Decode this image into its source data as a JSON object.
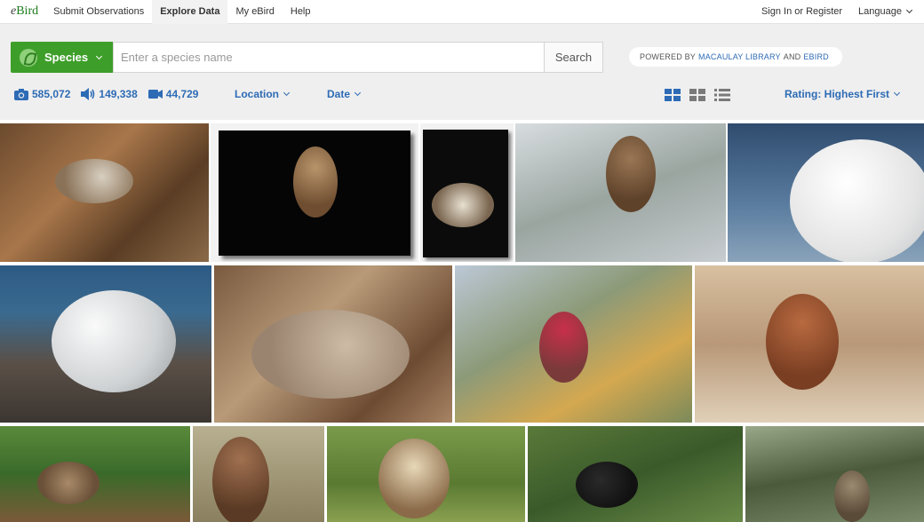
{
  "brand": {
    "logo_e": "e",
    "logo_rest": "Bird"
  },
  "nav": {
    "items": [
      "Submit Observations",
      "Explore Data",
      "My eBird",
      "Help"
    ],
    "active": "Explore Data",
    "sign_in": "Sign In or Register",
    "language": "Language"
  },
  "search": {
    "species_label": "Species",
    "placeholder": "Enter a species name",
    "button": "Search",
    "powered_prefix": "POWERED BY",
    "powered_link1": "MACAULAY LIBRARY",
    "powered_and": "AND",
    "powered_link2": "EBIRD"
  },
  "counts": {
    "photos": "585,072",
    "audio": "149,338",
    "video": "44,729"
  },
  "filters": {
    "location": "Location",
    "date": "Date",
    "rating": "Rating: Highest First"
  },
  "colors": {
    "accent_green": "#3e9e2a",
    "link_blue": "#2d6bb5"
  },
  "photos": [
    "white-throated sparrow on leaves",
    "owl on branch, black background",
    "owl in flight at night",
    "owl perched in tree",
    "gull portrait, white head",
    "gull standing on ground",
    "dove on leaves by fence",
    "red finch on branch",
    "brown sparrow on branch",
    "sparrow in grass",
    "hawk perched",
    "bird with striped face in grass",
    "black and white bird in shrub",
    "owl in tree foliage"
  ]
}
